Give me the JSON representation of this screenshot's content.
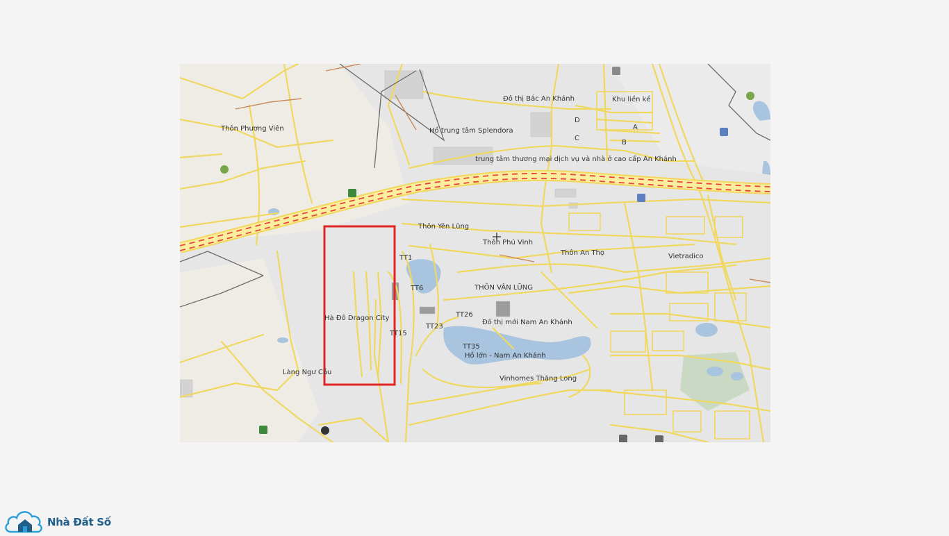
{
  "map": {
    "labels": {
      "bac_an_khanh": "Đô thị Bắc An Khánh",
      "khu_lien_ke": "Khu liền kề",
      "splendora": "Hồ trung tâm Splendora",
      "phuong_vien": "Thôn Phương Viên",
      "trung_tam_tm": "trung tâm thương mại dịch vụ và nhà ở cao cấp An Khánh",
      "yen_lung": "Thôn Yên Lũng",
      "phu_vinh": "Thôn Phú Vinh",
      "an_tho": "Thôn An Thọ",
      "vietradico": "Vietradico",
      "van_lung": "THÔN VÂN LŨNG",
      "ha_do_dragon": "Hà Đô Dragon City",
      "nam_an_khanh": "Đô thị mới Nam An Khánh",
      "ho_lon": "Hồ lớn - Nam An Khánh",
      "vinhomes": "Vinhomes Thăng Long",
      "lang_ngu_cau": "Làng Ngư Cầu",
      "d": "D",
      "a": "A",
      "c": "C",
      "b": "B",
      "tt1": "TT1",
      "tt6": "TT6",
      "tt26": "TT26",
      "tt23": "TT23",
      "tt15": "TT15",
      "tt35": "TT35"
    },
    "highlight_color": "#e02424",
    "road_color": "#f5e06b",
    "expressway_dash_color": "#e8433a",
    "water_color": "#a9c4de"
  },
  "logo": {
    "text": "Nhà Đất Số",
    "brand_color": "#1f5f8a"
  }
}
